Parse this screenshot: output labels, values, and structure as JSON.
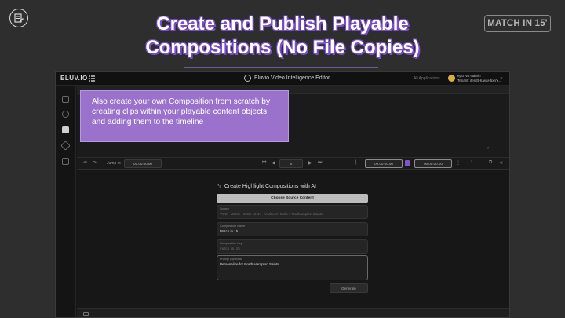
{
  "slide": {
    "title_line1": "Create and Publish Playable",
    "title_line2": "Compositions (No File Copies)",
    "badge": "MATCH IN 15'"
  },
  "app": {
    "brand": "ELUV.IO",
    "title": "Eluvio Video Intelligence Editor",
    "all_applications": "All Applications",
    "user": {
      "name": "epcr-viz-admin",
      "tenant": "Tenant: iten3tHLwaH5xnY..."
    },
    "sidebar_icons": [
      "grid-icon",
      "scissors-icon",
      "compose-icon",
      "tag-icon",
      "archive-icon"
    ]
  },
  "toolbar": {
    "jump_label": "Jump to",
    "jump_value": "00:00:00.00",
    "frame_value": "0",
    "timecode_in": "00:00:00.00",
    "timecode_out": "00:00:00.00"
  },
  "dialog": {
    "title": "Create Highlight Compositions with AI",
    "choose_button": "Choose Source Content",
    "fields": [
      {
        "label": "Source",
        "value": "VOD - Match - 2024-12-14 - Vodacom Bulls v Northampton Saints",
        "dim": true
      },
      {
        "label": "Composition Name",
        "value": "Match in 15",
        "dim": false
      },
      {
        "label": "Composition Key",
        "value": "match_in_15",
        "dim": true
      },
      {
        "label": "Prompt (optional)",
        "value": "Personalize for North Hampton Saints",
        "dim": false
      }
    ],
    "generate_button": "Generate"
  },
  "callout": {
    "text": "Also create your own Composition from scratch by creating clips within your playable content objects and adding them to the timeline"
  },
  "colors": {
    "accent": "#7b4fc8",
    "callout_bg": "#9b72cb",
    "background": "#2e2e2e"
  }
}
